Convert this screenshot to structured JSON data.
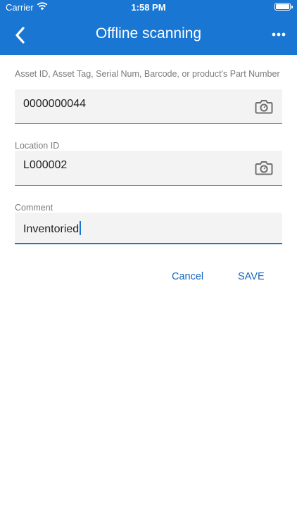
{
  "status_bar": {
    "carrier": "Carrier",
    "time": "1:58 PM"
  },
  "header": {
    "title": "Offline scanning",
    "back_icon": "chevron-left-icon",
    "menu_icon": "more-horizontal-icon",
    "background": "#1976d2"
  },
  "form": {
    "asset": {
      "label": "Asset ID, Asset Tag, Serial Num, Barcode, or product's Part Number",
      "value": "0000000044",
      "icon": "camera-icon"
    },
    "location": {
      "label": "Location ID",
      "value": "L000002",
      "icon": "camera-icon"
    },
    "comment": {
      "label": "Comment",
      "value": "Inventoried"
    }
  },
  "actions": {
    "cancel": "Cancel",
    "save": "SAVE"
  },
  "accent_color": "#1976d2"
}
